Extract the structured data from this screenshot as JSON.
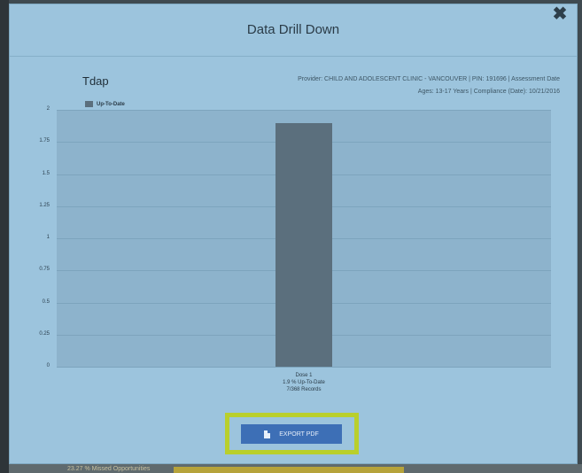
{
  "background": {
    "text": "23.27 % Missed Opportunities"
  },
  "modal": {
    "title": "Data Drill Down",
    "close_label": "✖"
  },
  "chart_header": {
    "title": "Tdap",
    "subtitle_line1": "Provider: CHILD AND ADOLESCENT CLINIC - VANCOUVER | PIN: 191696 | Assessment Date",
    "subtitle_line2": "Ages: 13-17 Years | Compliance (Date): 10/21/2016"
  },
  "chart_data": {
    "type": "bar",
    "categories": [
      "Dose 1"
    ],
    "series": [
      {
        "name": "Up-To-Date",
        "values": [
          1.9
        ]
      }
    ],
    "category_labels": [
      [
        "Dose 1",
        "1.9 % Up-To-Date",
        "7/368 Records"
      ]
    ],
    "ylim": [
      0,
      2
    ],
    "yticks": [
      "0",
      "0.25",
      "0.5",
      "0.75",
      "1",
      "1.25",
      "1.5",
      "1.75",
      "2"
    ],
    "grid": true,
    "legend_position": "top-left",
    "bar_color": "#5b6f7d"
  },
  "export": {
    "label": "EXPORT PDF",
    "icon": "pdf-file-icon"
  }
}
